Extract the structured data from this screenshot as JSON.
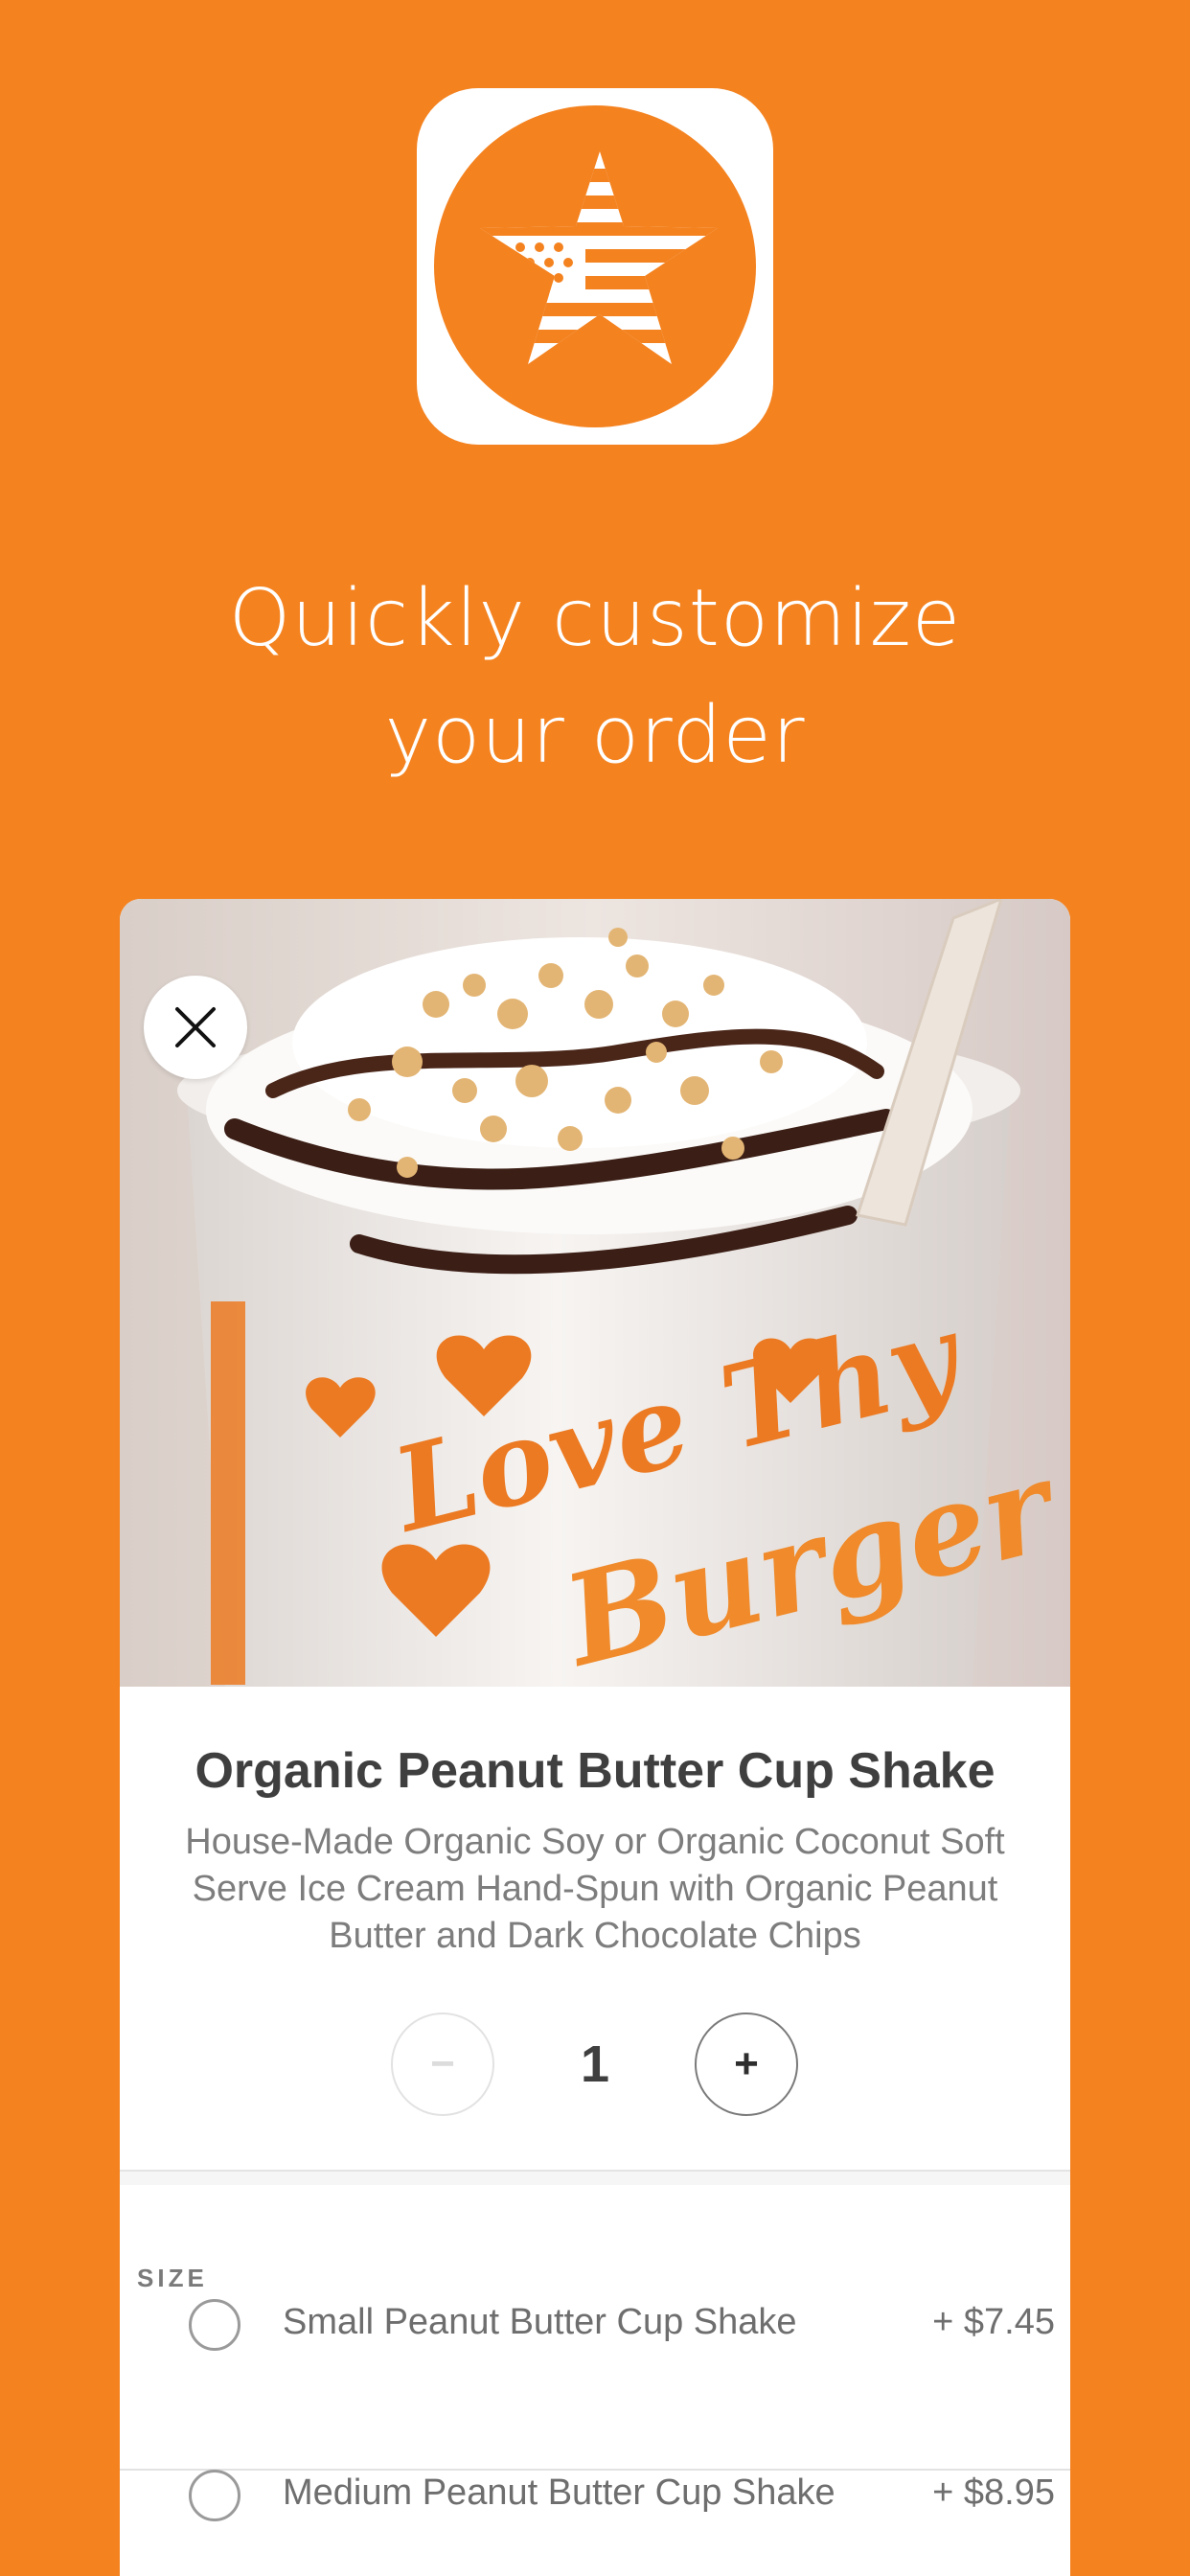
{
  "colors": {
    "brand": "#F4821F",
    "card": "#FFFFFF"
  },
  "app_icon": {
    "name": "star-flag-logo-icon"
  },
  "headline": {
    "line1": "Quickly customize",
    "line2": "your order"
  },
  "product": {
    "image_cup_text_1": "Love Thy",
    "image_cup_text_2": "Burger",
    "title": "Organic Peanut Butter Cup Shake",
    "description": "House-Made Organic Soy or Organic Coconut Soft Serve Ice Cream Hand-Spun with Organic Peanut Butter and Dark Chocolate Chips"
  },
  "quantity": {
    "minus": "−",
    "value": "1",
    "plus": "+"
  },
  "size_section": {
    "label": "SIZE",
    "options": [
      {
        "label": "Small Peanut Butter Cup Shake",
        "price": "+ $7.45",
        "selected": false
      },
      {
        "label": "Medium Peanut Butter Cup Shake",
        "price": "+ $8.95",
        "selected": false
      }
    ]
  }
}
